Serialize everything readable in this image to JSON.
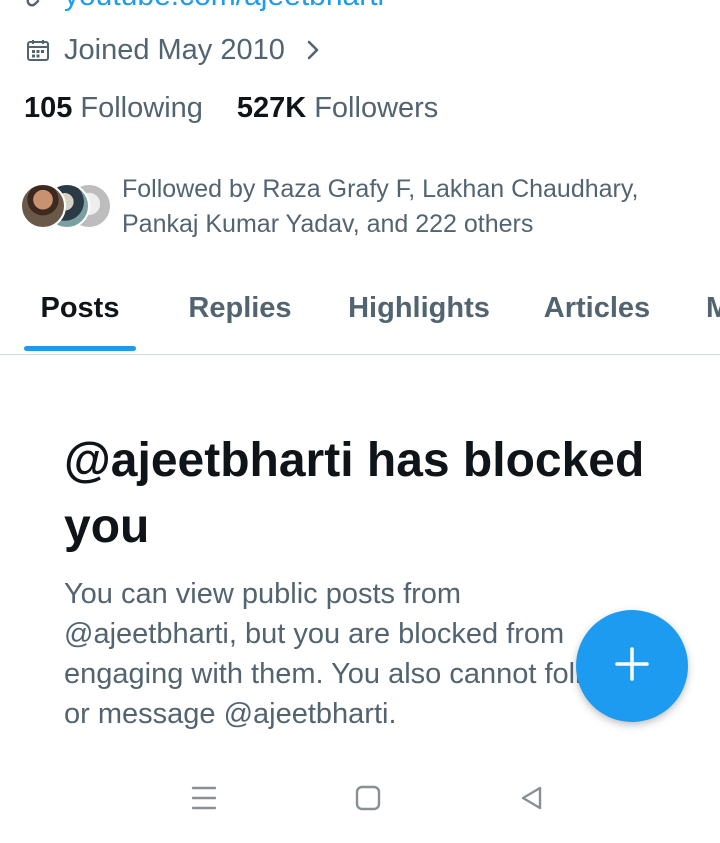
{
  "profile": {
    "website_link": "youtube.com/ajeetbharti",
    "joined_text": "Joined May 2010",
    "following_count": "105",
    "following_label": "Following",
    "followers_count": "527K",
    "followers_label": "Followers",
    "followed_by_text": "Followed by Raza Grafy F, Lakhan Chaudhary, Pankaj Kumar Yadav, and 222 others"
  },
  "tabs": [
    {
      "label": "Posts",
      "active": true
    },
    {
      "label": "Replies",
      "active": false
    },
    {
      "label": "Highlights",
      "active": false
    },
    {
      "label": "Articles",
      "active": false
    }
  ],
  "blocked": {
    "title": "@ajeetbharti has blocked you",
    "body": "You can view public posts from @ajeetbharti, but you are blocked from engaging with them. You also cannot follow or message @ajeetbharti."
  },
  "icons": {
    "link": "link-icon",
    "calendar": "calendar-icon",
    "chevron": "chevron-right-icon",
    "compose": "plus-icon",
    "nav_menu": "menu-icon",
    "nav_home": "home-square-icon",
    "nav_back": "back-triangle-icon"
  },
  "colors": {
    "accent": "#1d9bf0",
    "text_primary": "#0f1419",
    "text_secondary": "#536471"
  }
}
